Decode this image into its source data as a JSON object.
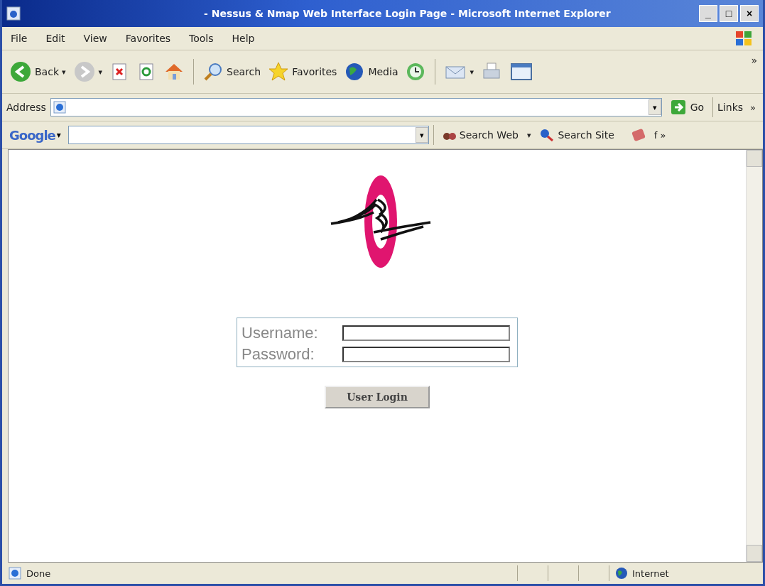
{
  "window": {
    "title": "- Nessus & Nmap Web Interface Login Page - Microsoft Internet Explorer",
    "controls": [
      "_",
      "□",
      "×"
    ]
  },
  "menu": [
    "File",
    "Edit",
    "View",
    "Favorites",
    "Tools",
    "Help"
  ],
  "toolbar": [
    {
      "kind": "back",
      "label": "Back",
      "caret": "▾"
    },
    {
      "kind": "forward",
      "caret": "▾"
    },
    {
      "kind": "stop"
    },
    {
      "kind": "refresh"
    },
    {
      "kind": "home"
    },
    {
      "kind": "sep"
    },
    {
      "kind": "search",
      "label": "Search"
    },
    {
      "kind": "favorites",
      "label": "Favorites"
    },
    {
      "kind": "media",
      "label": "Media"
    },
    {
      "kind": "history"
    },
    {
      "kind": "sep"
    },
    {
      "kind": "mail",
      "caret": "▾"
    },
    {
      "kind": "print"
    },
    {
      "kind": "edit"
    }
  ],
  "toolbar_more": "»",
  "address": {
    "label": "Address",
    "dropdown": "▾",
    "go": "Go",
    "links": "Links",
    "links_more": "»"
  },
  "google": {
    "logo": "Google",
    "logo_caret": "▾",
    "dropdown": "▾",
    "search_web": "Search Web",
    "caret": "▾",
    "search_site": "Search Site",
    "tail": "f »"
  },
  "login": {
    "fields": [
      {
        "label": "Username:"
      },
      {
        "label": "Password:"
      }
    ],
    "button": "User Login"
  },
  "status": {
    "text": "Done",
    "zone": "Internet"
  }
}
